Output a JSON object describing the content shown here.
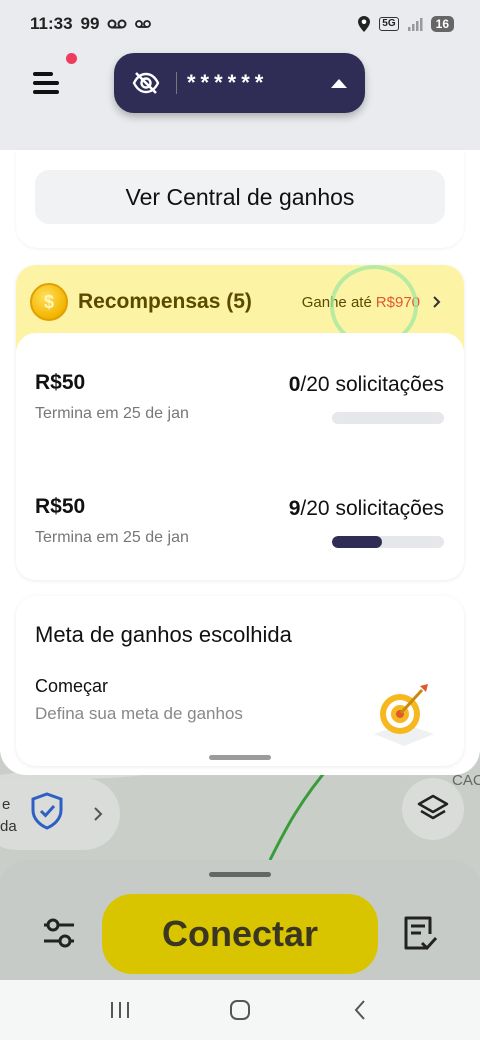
{
  "status_bar": {
    "time": "11:33",
    "notification_icons": "99",
    "network": "5G",
    "battery": "16"
  },
  "top_bar": {
    "masked_earnings": "******"
  },
  "central": {
    "button_label": "Ver Central de ganhos"
  },
  "rewards": {
    "title": "Recompensas (5)",
    "offer_prefix": "Ganhe até",
    "offer_amount": "R$970",
    "items": [
      {
        "amount": "R$50",
        "deadline": "Termina em 25 de jan",
        "done": "0",
        "total_label": "/20 solicitações",
        "progress": 0
      },
      {
        "amount": "R$50",
        "deadline": "Termina em 25 de jan",
        "done": "9",
        "total_label": "/20 solicitações",
        "progress": 0.45
      }
    ]
  },
  "goal": {
    "title": "Meta de ganhos escolhida",
    "start_label": "Começar",
    "subtitle": "Defina sua meta de ganhos"
  },
  "map": {
    "shield_text_line1": "e",
    "shield_text_line2": "da",
    "corner_label": "CAC"
  },
  "bottom": {
    "connect_label": "Conectar"
  },
  "colors": {
    "pill_bg": "#2f2c55",
    "reward_header_bg": "#fdf3a5",
    "connect_bg": "#d8c500",
    "accent_red": "#e0592e"
  }
}
